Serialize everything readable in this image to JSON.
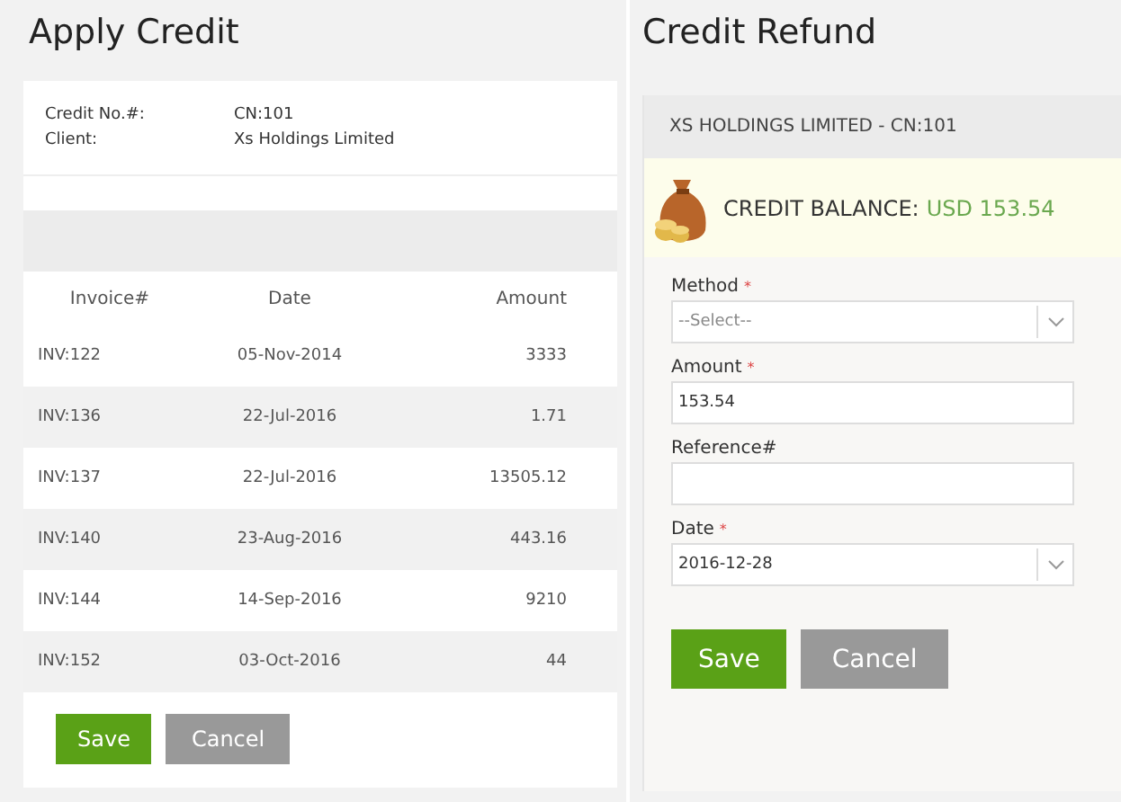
{
  "apply_credit": {
    "title": "Apply Credit",
    "info": [
      {
        "label": "Credit No.#:",
        "value": "CN:101"
      },
      {
        "label": "Client:",
        "value": "Xs Holdings Limited"
      }
    ],
    "table": {
      "columns": [
        "Invoice#",
        "Date",
        "Amount"
      ],
      "rows": [
        [
          "INV:122",
          "05-Nov-2014",
          "3333"
        ],
        [
          "INV:136",
          "22-Jul-2016",
          "1.71"
        ],
        [
          "INV:137",
          "22-Jul-2016",
          "13505.12"
        ],
        [
          "INV:140",
          "23-Aug-2016",
          "443.16"
        ],
        [
          "INV:144",
          "14-Sep-2016",
          "9210"
        ],
        [
          "INV:152",
          "03-Oct-2016",
          "44"
        ]
      ]
    },
    "buttons": [
      {
        "label": "Save",
        "kind": "primary"
      },
      {
        "label": "Cancel",
        "kind": "secondary"
      }
    ]
  },
  "credit_refund": {
    "title": "Credit Refund",
    "header": "XS HOLDINGS LIMITED - CN:101",
    "balance": {
      "label": "CREDIT BALANCE:",
      "amount": "USD 153.54"
    },
    "fields": [
      {
        "label": "Method",
        "required_mark": "*",
        "kind": "select",
        "placeholder": "--Select--"
      },
      {
        "label": "Amount",
        "required_mark": "*",
        "kind": "text",
        "value": "153.54"
      },
      {
        "label": "Reference#",
        "kind": "text"
      },
      {
        "label": "Date",
        "required_mark": "*",
        "kind": "select",
        "value": "2016-12-28"
      }
    ],
    "buttons": [
      {
        "label": "Save",
        "kind": "primary"
      },
      {
        "label": "Cancel",
        "kind": "secondary"
      }
    ]
  }
}
